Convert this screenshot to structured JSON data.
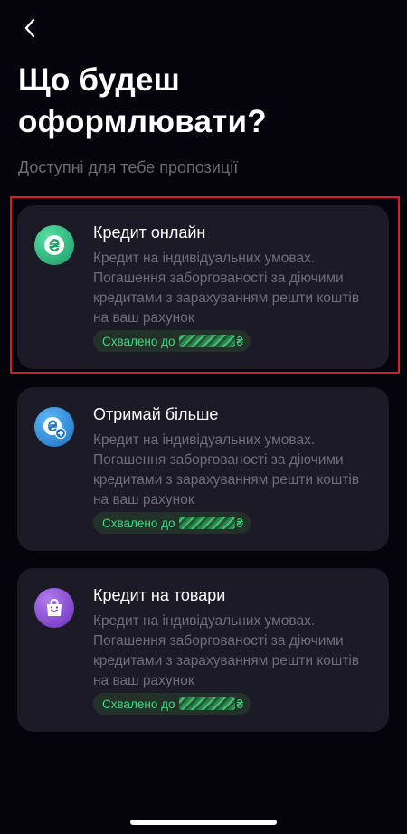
{
  "header": {
    "title": "Що будеш оформлювати?",
    "subtitle": "Доступні для тебе пропозиції"
  },
  "offers": [
    {
      "name": "Кредит онлайн",
      "description": "Кредит на індивідуальних умовах. Погашення заборгованості за діючими кредитами з зарахуванням решти коштів на ваш рахунок",
      "badge_prefix": "Схвалено до",
      "currency": "₴",
      "icon": "hryvnia-coin-icon",
      "icon_color": "#2fbf7f"
    },
    {
      "name": "Отримай більше",
      "description": "Кредит на індивідуальних умовах. Погашення заборгованості за діючими кредитами з зарахуванням решти коштів на ваш рахунок",
      "badge_prefix": "Схвалено до",
      "currency": "₴",
      "icon": "hryvnia-plus-icon",
      "icon_color": "#2a8fe0"
    },
    {
      "name": "Кредит на товари",
      "description": "Кредит на індивідуальних умовах. Погашення заборгованості за діючими кредитами з зарахуванням решти коштів на ваш рахунок",
      "badge_prefix": "Схвалено до",
      "currency": "₴",
      "icon": "shopping-bag-icon",
      "icon_color": "#8e4fd6"
    }
  ],
  "colors": {
    "background": "#05040d",
    "card": "#1b1a26",
    "approved_text": "#3fd67e",
    "highlight": "#d61f20"
  }
}
